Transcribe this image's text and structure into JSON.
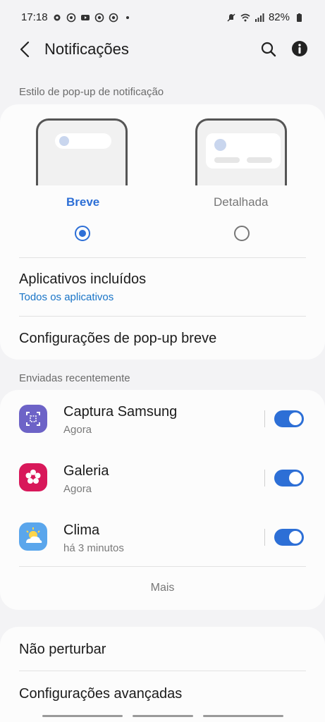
{
  "status_bar": {
    "time": "17:18",
    "battery": "82%",
    "left_icons": [
      "gear-icon",
      "whatsapp-icon",
      "youtube-icon",
      "chrome-icon",
      "chrome-icon",
      "dot-icon"
    ],
    "right_icons": [
      "mute-icon",
      "wifi-icon",
      "signal-icon",
      "battery-icon"
    ]
  },
  "header": {
    "title": "Notificações"
  },
  "popup_style": {
    "section_label": "Estilo de pop-up de notificação",
    "options": [
      {
        "label": "Breve",
        "selected": true
      },
      {
        "label": "Detalhada",
        "selected": false
      }
    ]
  },
  "settings_rows": {
    "included_apps_title": "Aplicativos incluídos",
    "included_apps_value": "Todos os aplicativos",
    "brief_popup_settings": "Configurações de pop-up breve"
  },
  "recent": {
    "section_label": "Enviadas recentemente",
    "apps": [
      {
        "name": "Captura Samsung",
        "time": "Agora",
        "enabled": true
      },
      {
        "name": "Galeria",
        "time": "Agora",
        "enabled": true
      },
      {
        "name": "Clima",
        "time": "há 3 minutos",
        "enabled": true
      }
    ],
    "more_label": "Mais"
  },
  "bottom_rows": {
    "do_not_disturb": "Não perturbar",
    "advanced_settings": "Configurações avançadas"
  },
  "colors": {
    "accent": "#2d6fd6",
    "link": "#1874c7",
    "background": "#f3f3f5",
    "card": "#fcfcfc"
  }
}
